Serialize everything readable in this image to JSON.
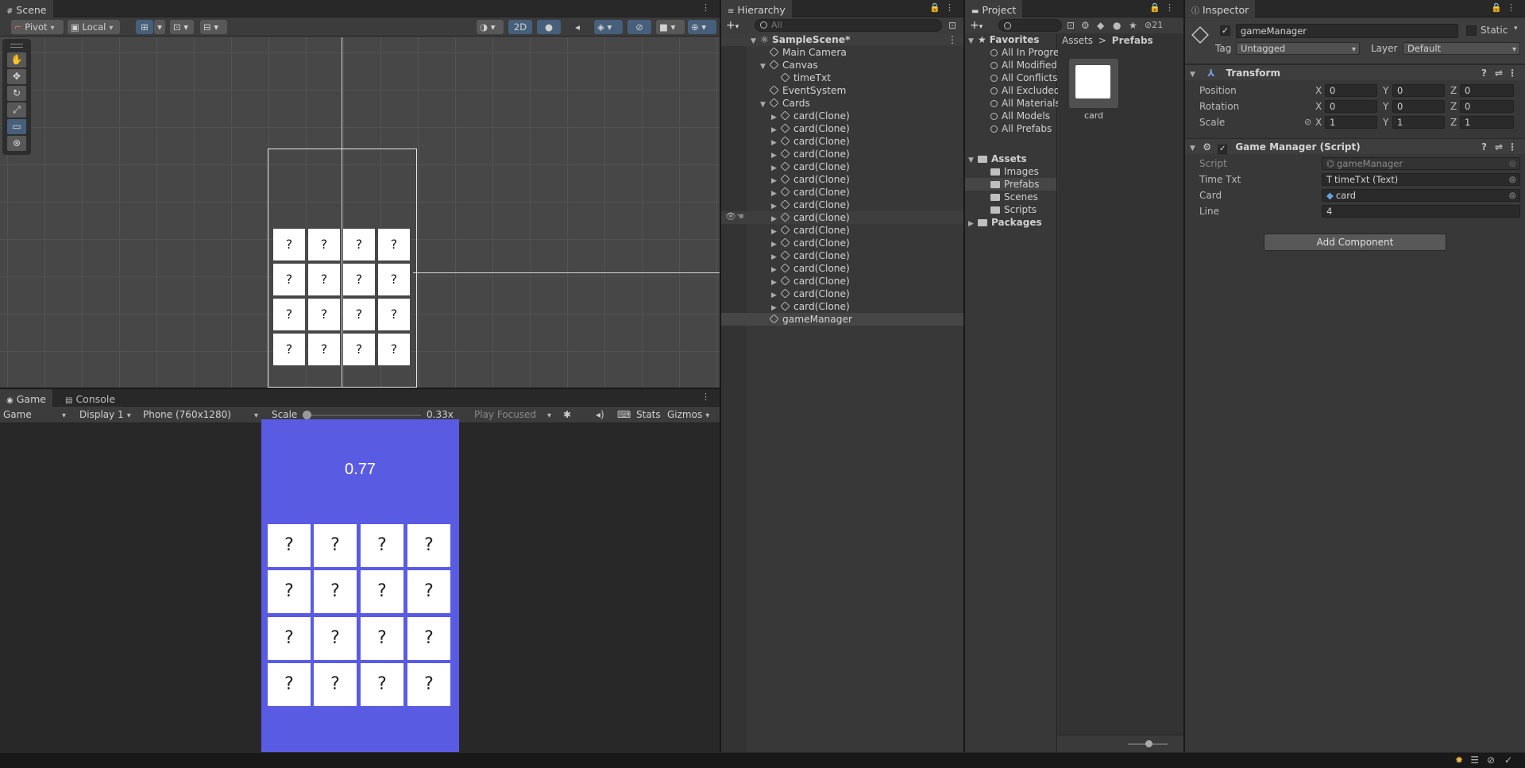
{
  "scene": {
    "tab": "Scene",
    "pivot": "Pivot",
    "local": "Local",
    "mode2d": "2D",
    "card_mark": "?"
  },
  "game": {
    "tab_game": "Game",
    "tab_console": "Console",
    "view": "Game",
    "display": "Display 1",
    "resolution": "Phone (760x1280)",
    "scale_label": "Scale",
    "scale_value": "0.33x",
    "play_mode": "Play Focused",
    "stats": "Stats",
    "gizmos": "Gizmos",
    "timer": "0.77",
    "card_mark": "?",
    "bg_color": "#5a5be3"
  },
  "hierarchy": {
    "tab": "Hierarchy",
    "search_placeholder": "All",
    "scene_name": "SampleScene*",
    "main_camera": "Main Camera",
    "canvas": "Canvas",
    "time_txt": "timeTxt",
    "event_system": "EventSystem",
    "cards": "Cards",
    "card_clones": [
      "card(Clone)",
      "card(Clone)",
      "card(Clone)",
      "card(Clone)",
      "card(Clone)",
      "card(Clone)",
      "card(Clone)",
      "card(Clone)",
      "card(Clone)",
      "card(Clone)",
      "card(Clone)",
      "card(Clone)",
      "card(Clone)",
      "card(Clone)",
      "card(Clone)",
      "card(Clone)"
    ],
    "game_manager": "gameManager"
  },
  "project": {
    "tab": "Project",
    "hidden_count": "21",
    "favorites": "Favorites",
    "fav_items": [
      "All In Progre",
      "All Modified",
      "All Conflicts",
      "All Excluded",
      "All Materials",
      "All Models",
      "All Prefabs"
    ],
    "assets": "Assets",
    "asset_folders": [
      "Images",
      "Prefabs",
      "Scenes",
      "Scripts"
    ],
    "packages": "Packages",
    "breadcrumb_root": "Assets",
    "breadcrumb_sep": ">",
    "breadcrumb_current": "Prefabs",
    "prefab_name": "card"
  },
  "inspector": {
    "tab": "Inspector",
    "object_name": "gameManager",
    "static_label": "Static",
    "tag_label": "Tag",
    "tag_value": "Untagged",
    "layer_label": "Layer",
    "layer_value": "Default",
    "transform_title": "Transform",
    "position_label": "Position",
    "rotation_label": "Rotation",
    "scale_label": "Scale",
    "axis_x": "X",
    "axis_y": "Y",
    "axis_z": "Z",
    "position": [
      "0",
      "0",
      "0"
    ],
    "rotation": [
      "0",
      "0",
      "0"
    ],
    "scale": [
      "1",
      "1",
      "1"
    ],
    "script_component_title": "Game Manager (Script)",
    "script_label": "Script",
    "script_value": "gameManager",
    "time_txt_label": "Time Txt",
    "time_txt_value": "timeTxt (Text)",
    "card_label": "Card",
    "card_value": "card",
    "line_label": "Line",
    "line_value": "4",
    "add_component": "Add Component"
  }
}
